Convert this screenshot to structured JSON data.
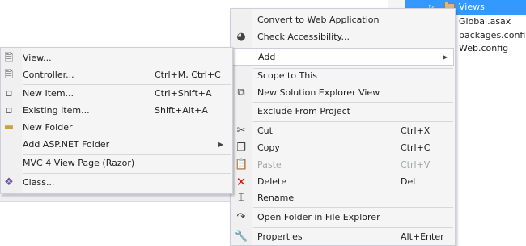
{
  "explorer": {
    "selected": "Views",
    "items": [
      "Global.asax",
      "packages.config",
      "Web.config"
    ]
  },
  "context_menu": {
    "items": [
      {
        "label": "Convert to Web Application",
        "icon": "blank"
      },
      {
        "label": "Check Accessibility...",
        "icon": "accessibility-icon"
      },
      {
        "label": "Add",
        "submenu": true
      },
      {
        "label": "Scope to This"
      },
      {
        "label": "New Solution Explorer View",
        "icon": "new-window-icon"
      },
      {
        "label": "Exclude From Project"
      },
      {
        "label": "Cut",
        "shortcut": "Ctrl+X",
        "icon": "scissors-icon"
      },
      {
        "label": "Copy",
        "shortcut": "Ctrl+C",
        "icon": "copy-icon"
      },
      {
        "label": "Paste",
        "shortcut": "Ctrl+V",
        "icon": "paste-icon",
        "disabled": true
      },
      {
        "label": "Delete",
        "shortcut": "Del",
        "icon": "delete-icon"
      },
      {
        "label": "Rename",
        "icon": "rename-icon"
      },
      {
        "label": "Open Folder in File Explorer",
        "icon": "refresh-arrow-icon"
      },
      {
        "label": "Properties",
        "shortcut": "Alt+Enter",
        "icon": "wrench-icon"
      }
    ]
  },
  "add_submenu": {
    "items": [
      {
        "label": "View...",
        "icon": "view-file-icon"
      },
      {
        "label": "Controller...",
        "shortcut": "Ctrl+M, Ctrl+C",
        "icon": "controller-file-icon"
      },
      {
        "label": "New Item...",
        "shortcut": "Ctrl+Shift+A",
        "icon": "new-item-icon"
      },
      {
        "label": "Existing Item...",
        "shortcut": "Shift+Alt+A",
        "icon": "existing-item-icon"
      },
      {
        "label": "New Folder",
        "icon": "new-folder-icon"
      },
      {
        "label": "Add ASP.NET Folder",
        "submenu": true
      },
      {
        "label": "MVC 4 View Page (Razor)"
      },
      {
        "label": "Class...",
        "icon": "class-icon"
      }
    ]
  },
  "colors": {
    "selection": "#3399ff",
    "menu_bg": "#f5f5f5",
    "delete_red": "#e51400"
  }
}
